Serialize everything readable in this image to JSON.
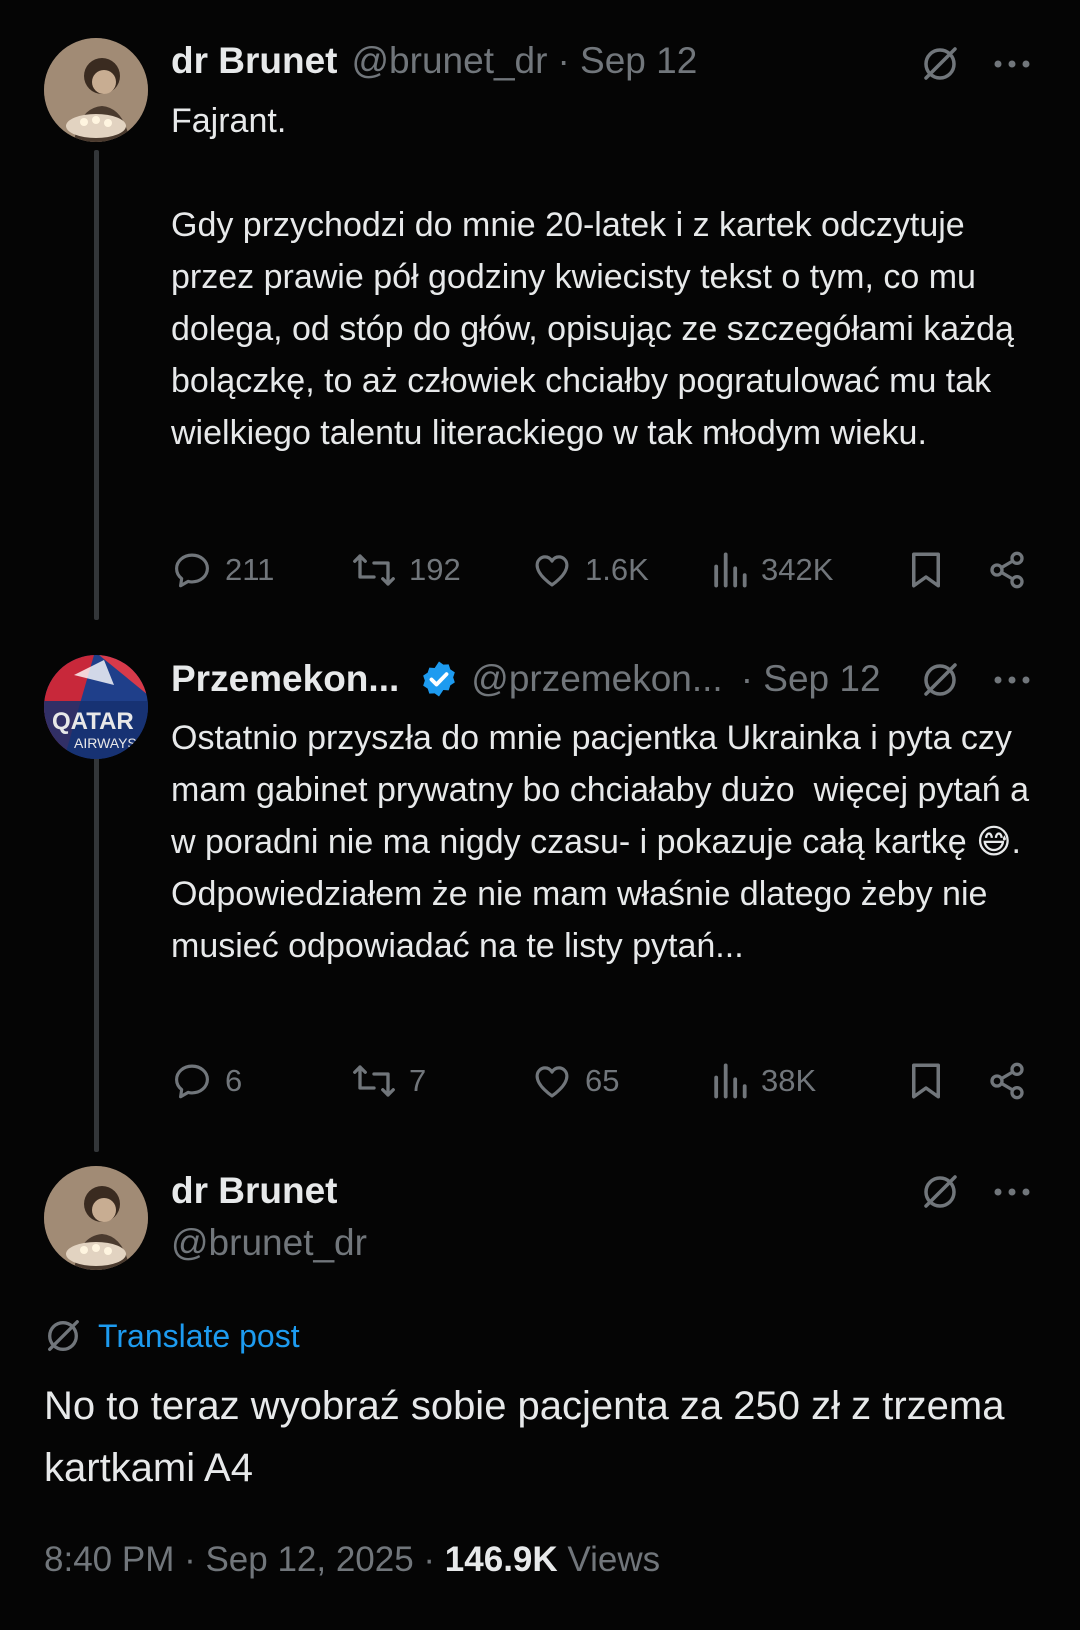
{
  "tweets": [
    {
      "name": "dr Brunet",
      "handle": "@brunet_dr",
      "date": "· Sep 12",
      "text": "Fajrant.\n\nGdy przychodzi do mnie 20-latek i z kartek odczytuje przez prawie pół godziny kwiecisty tekst o tym, co mu dolega, od stóp do głów, opisując ze szczegółami każdą bolączkę, to aż człowiek chciałby pogratulować mu tak wielkiego talentu literackiego w tak młodym wieku.",
      "replies": "211",
      "reposts": "192",
      "likes": "1.6K",
      "views": "342K"
    },
    {
      "name": "Przemekon...",
      "handle": "@przemekon...",
      "date": "· Sep 12",
      "text": "Ostatnio przyszła do mnie pacjentka Ukrainka i pyta czy mam gabinet prywatny bo chciałaby dużo  więcej pytań a w poradni nie ma nigdy czasu- i pokazuje całą kartkę 😅.\nOdpowiedziałem że nie mam właśnie dlatego żeby nie musieć odpowiadać na te listy pytań...",
      "replies": "6",
      "reposts": "7",
      "likes": "65",
      "views": "38K"
    }
  ],
  "main": {
    "name": "dr Brunet",
    "handle": "@brunet_dr",
    "translate": "Translate post",
    "text": "No to teraz wyobraź sobie pacjenta za 250 zł z trzema kartkami A4",
    "time": "8:40 PM · Sep 12, 2025 · ",
    "views_count": "146.9K",
    "views_label": " Views"
  },
  "avatar2_text": [
    "QATAR",
    "AIRWAYS"
  ],
  "icons": {
    "grok": "grok-slash-icon",
    "more": "more-dots-icon",
    "reply": "reply-bubble-icon",
    "repost": "repost-icon",
    "like": "heart-icon",
    "views": "views-bars-icon",
    "bookmark": "bookmark-icon",
    "share": "share-icon",
    "verified": "verified-badge-icon"
  },
  "colors": {
    "background": "#050505",
    "text": "#e7e9ea",
    "muted": "#71767b",
    "accent": "#1d9bf0"
  }
}
